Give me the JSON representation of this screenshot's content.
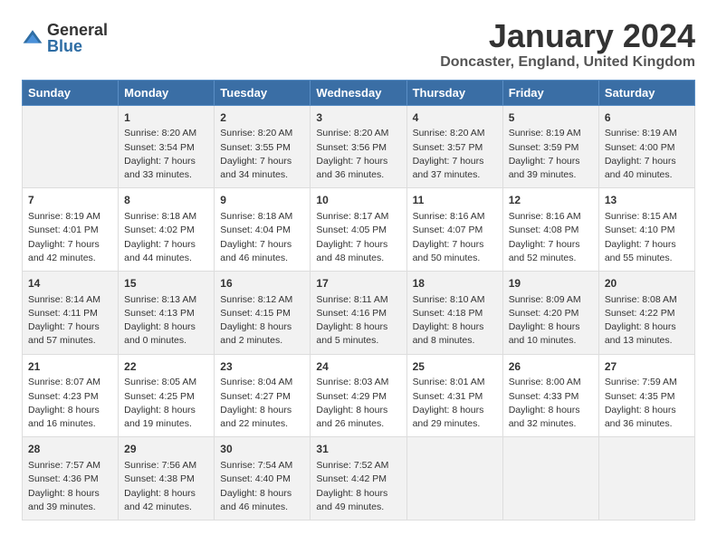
{
  "header": {
    "logo_general": "General",
    "logo_blue": "Blue",
    "month_title": "January 2024",
    "location": "Doncaster, England, United Kingdom"
  },
  "days_of_week": [
    "Sunday",
    "Monday",
    "Tuesday",
    "Wednesday",
    "Thursday",
    "Friday",
    "Saturday"
  ],
  "weeks": [
    [
      {
        "day": "",
        "info": ""
      },
      {
        "day": "1",
        "info": "Sunrise: 8:20 AM\nSunset: 3:54 PM\nDaylight: 7 hours\nand 33 minutes."
      },
      {
        "day": "2",
        "info": "Sunrise: 8:20 AM\nSunset: 3:55 PM\nDaylight: 7 hours\nand 34 minutes."
      },
      {
        "day": "3",
        "info": "Sunrise: 8:20 AM\nSunset: 3:56 PM\nDaylight: 7 hours\nand 36 minutes."
      },
      {
        "day": "4",
        "info": "Sunrise: 8:20 AM\nSunset: 3:57 PM\nDaylight: 7 hours\nand 37 minutes."
      },
      {
        "day": "5",
        "info": "Sunrise: 8:19 AM\nSunset: 3:59 PM\nDaylight: 7 hours\nand 39 minutes."
      },
      {
        "day": "6",
        "info": "Sunrise: 8:19 AM\nSunset: 4:00 PM\nDaylight: 7 hours\nand 40 minutes."
      }
    ],
    [
      {
        "day": "7",
        "info": "Sunrise: 8:19 AM\nSunset: 4:01 PM\nDaylight: 7 hours\nand 42 minutes."
      },
      {
        "day": "8",
        "info": "Sunrise: 8:18 AM\nSunset: 4:02 PM\nDaylight: 7 hours\nand 44 minutes."
      },
      {
        "day": "9",
        "info": "Sunrise: 8:18 AM\nSunset: 4:04 PM\nDaylight: 7 hours\nand 46 minutes."
      },
      {
        "day": "10",
        "info": "Sunrise: 8:17 AM\nSunset: 4:05 PM\nDaylight: 7 hours\nand 48 minutes."
      },
      {
        "day": "11",
        "info": "Sunrise: 8:16 AM\nSunset: 4:07 PM\nDaylight: 7 hours\nand 50 minutes."
      },
      {
        "day": "12",
        "info": "Sunrise: 8:16 AM\nSunset: 4:08 PM\nDaylight: 7 hours\nand 52 minutes."
      },
      {
        "day": "13",
        "info": "Sunrise: 8:15 AM\nSunset: 4:10 PM\nDaylight: 7 hours\nand 55 minutes."
      }
    ],
    [
      {
        "day": "14",
        "info": "Sunrise: 8:14 AM\nSunset: 4:11 PM\nDaylight: 7 hours\nand 57 minutes."
      },
      {
        "day": "15",
        "info": "Sunrise: 8:13 AM\nSunset: 4:13 PM\nDaylight: 8 hours\nand 0 minutes."
      },
      {
        "day": "16",
        "info": "Sunrise: 8:12 AM\nSunset: 4:15 PM\nDaylight: 8 hours\nand 2 minutes."
      },
      {
        "day": "17",
        "info": "Sunrise: 8:11 AM\nSunset: 4:16 PM\nDaylight: 8 hours\nand 5 minutes."
      },
      {
        "day": "18",
        "info": "Sunrise: 8:10 AM\nSunset: 4:18 PM\nDaylight: 8 hours\nand 8 minutes."
      },
      {
        "day": "19",
        "info": "Sunrise: 8:09 AM\nSunset: 4:20 PM\nDaylight: 8 hours\nand 10 minutes."
      },
      {
        "day": "20",
        "info": "Sunrise: 8:08 AM\nSunset: 4:22 PM\nDaylight: 8 hours\nand 13 minutes."
      }
    ],
    [
      {
        "day": "21",
        "info": "Sunrise: 8:07 AM\nSunset: 4:23 PM\nDaylight: 8 hours\nand 16 minutes."
      },
      {
        "day": "22",
        "info": "Sunrise: 8:05 AM\nSunset: 4:25 PM\nDaylight: 8 hours\nand 19 minutes."
      },
      {
        "day": "23",
        "info": "Sunrise: 8:04 AM\nSunset: 4:27 PM\nDaylight: 8 hours\nand 22 minutes."
      },
      {
        "day": "24",
        "info": "Sunrise: 8:03 AM\nSunset: 4:29 PM\nDaylight: 8 hours\nand 26 minutes."
      },
      {
        "day": "25",
        "info": "Sunrise: 8:01 AM\nSunset: 4:31 PM\nDaylight: 8 hours\nand 29 minutes."
      },
      {
        "day": "26",
        "info": "Sunrise: 8:00 AM\nSunset: 4:33 PM\nDaylight: 8 hours\nand 32 minutes."
      },
      {
        "day": "27",
        "info": "Sunrise: 7:59 AM\nSunset: 4:35 PM\nDaylight: 8 hours\nand 36 minutes."
      }
    ],
    [
      {
        "day": "28",
        "info": "Sunrise: 7:57 AM\nSunset: 4:36 PM\nDaylight: 8 hours\nand 39 minutes."
      },
      {
        "day": "29",
        "info": "Sunrise: 7:56 AM\nSunset: 4:38 PM\nDaylight: 8 hours\nand 42 minutes."
      },
      {
        "day": "30",
        "info": "Sunrise: 7:54 AM\nSunset: 4:40 PM\nDaylight: 8 hours\nand 46 minutes."
      },
      {
        "day": "31",
        "info": "Sunrise: 7:52 AM\nSunset: 4:42 PM\nDaylight: 8 hours\nand 49 minutes."
      },
      {
        "day": "",
        "info": ""
      },
      {
        "day": "",
        "info": ""
      },
      {
        "day": "",
        "info": ""
      }
    ]
  ]
}
